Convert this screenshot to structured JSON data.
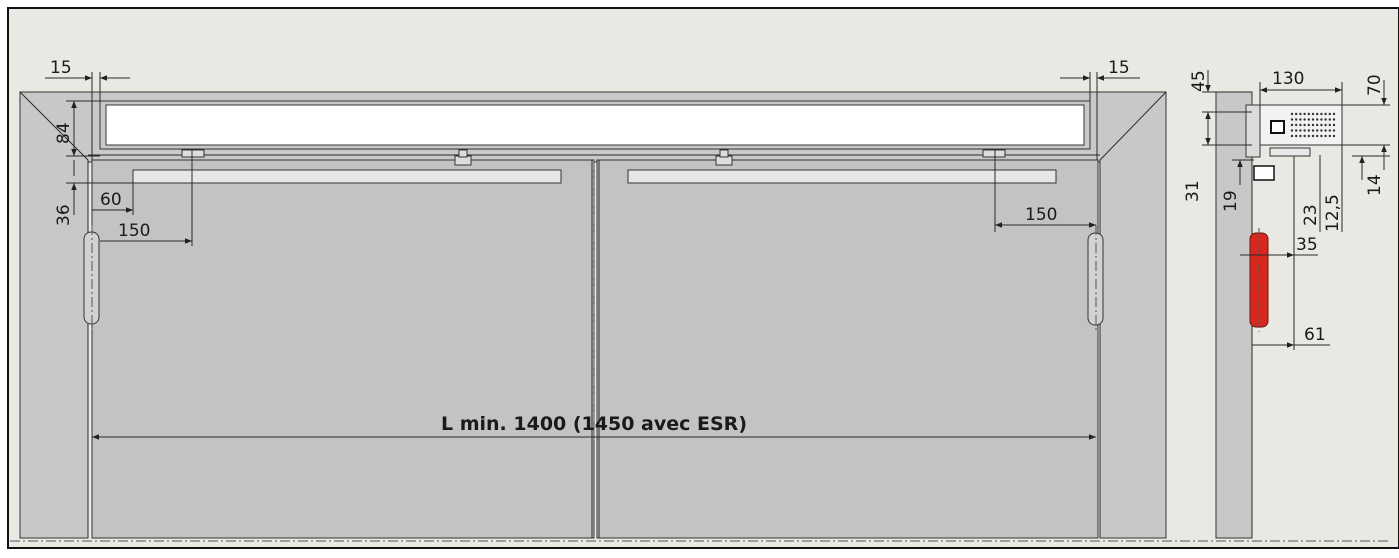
{
  "colors": {
    "background": "#e9e8e2",
    "wall": "#c8c8c8",
    "door": "#c3c3c3",
    "closer_body": "#ffffff",
    "hinge_highlight": "#d8281e"
  },
  "dimensions_front": {
    "left_offset": "15",
    "right_offset": "15",
    "closer_height": "84",
    "arm_height": "36",
    "left_arm_inset": "60",
    "left_arm_reach": "150",
    "right_arm_reach": "150",
    "length_label": "L min. 1400 (1450 avec ESR)"
  },
  "dimensions_side": {
    "top_offset": "45",
    "depth": "130",
    "right_height": "70",
    "left_31": "31",
    "left_19": "19",
    "d23": "23",
    "d12_5": "12,5",
    "d14": "14",
    "hinge_35": "35",
    "hinge_61": "61"
  }
}
